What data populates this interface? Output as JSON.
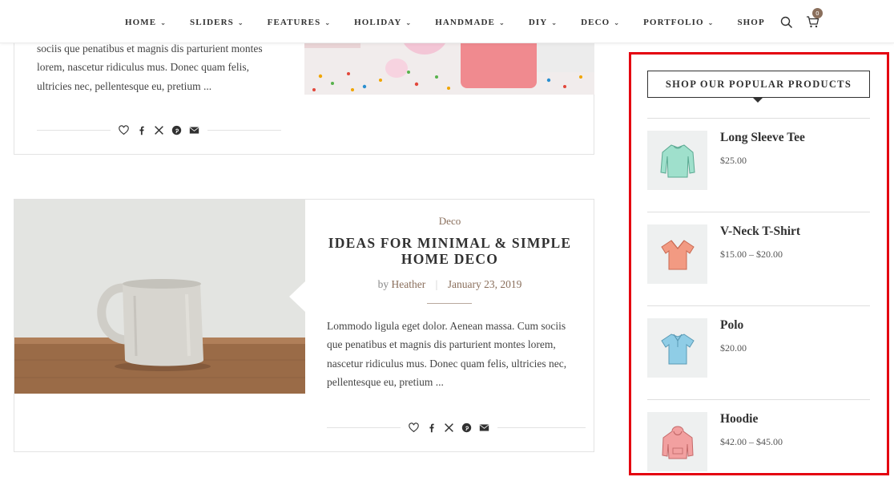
{
  "nav": {
    "items": [
      {
        "label": "HOME"
      },
      {
        "label": "SLIDERS"
      },
      {
        "label": "FEATURES"
      },
      {
        "label": "HOLIDAY"
      },
      {
        "label": "HANDMADE"
      },
      {
        "label": "DIY"
      },
      {
        "label": "DECO"
      },
      {
        "label": "PORTFOLIO"
      }
    ],
    "shop_label": "SHOP",
    "cart_count": "0"
  },
  "post1": {
    "excerpt": "sociis que penatibus et magnis dis parturient montes lorem, nascetur ridiculus mus. Donec quam felis, ultricies nec, pellentesque eu, pretium ..."
  },
  "post2": {
    "category": "Deco",
    "title": "IDEAS FOR MINIMAL & SIMPLE HOME DECO",
    "author_prefix": "by",
    "author": "Heather",
    "date": "January 23, 2019",
    "excerpt": "Lommodo ligula eget dolor. Aenean massa. Cum sociis que penatibus et magnis dis parturient montes lorem, nascetur ridiculus mus. Donec quam felis, ultricies nec, pellentesque eu, pretium ..."
  },
  "share_icons": [
    "heart-icon",
    "facebook-icon",
    "x-icon",
    "pinterest-icon",
    "envelope-icon"
  ],
  "widget": {
    "title": "SHOP OUR POPULAR PRODUCTS",
    "products": [
      {
        "name": "Long Sleeve Tee",
        "price": "$25.00",
        "color": "#9fe0cc"
      },
      {
        "name": "V-Neck T-Shirt",
        "price": "$15.00 – $20.00",
        "color": "#f29a82"
      },
      {
        "name": "Polo",
        "price": "$20.00",
        "color": "#8fcde6"
      },
      {
        "name": "Hoodie",
        "price": "$42.00 – $45.00",
        "color": "#f2a0a0"
      }
    ]
  },
  "colors": {
    "accent": "#8a6f5c",
    "highlight_border": "#e40010"
  }
}
